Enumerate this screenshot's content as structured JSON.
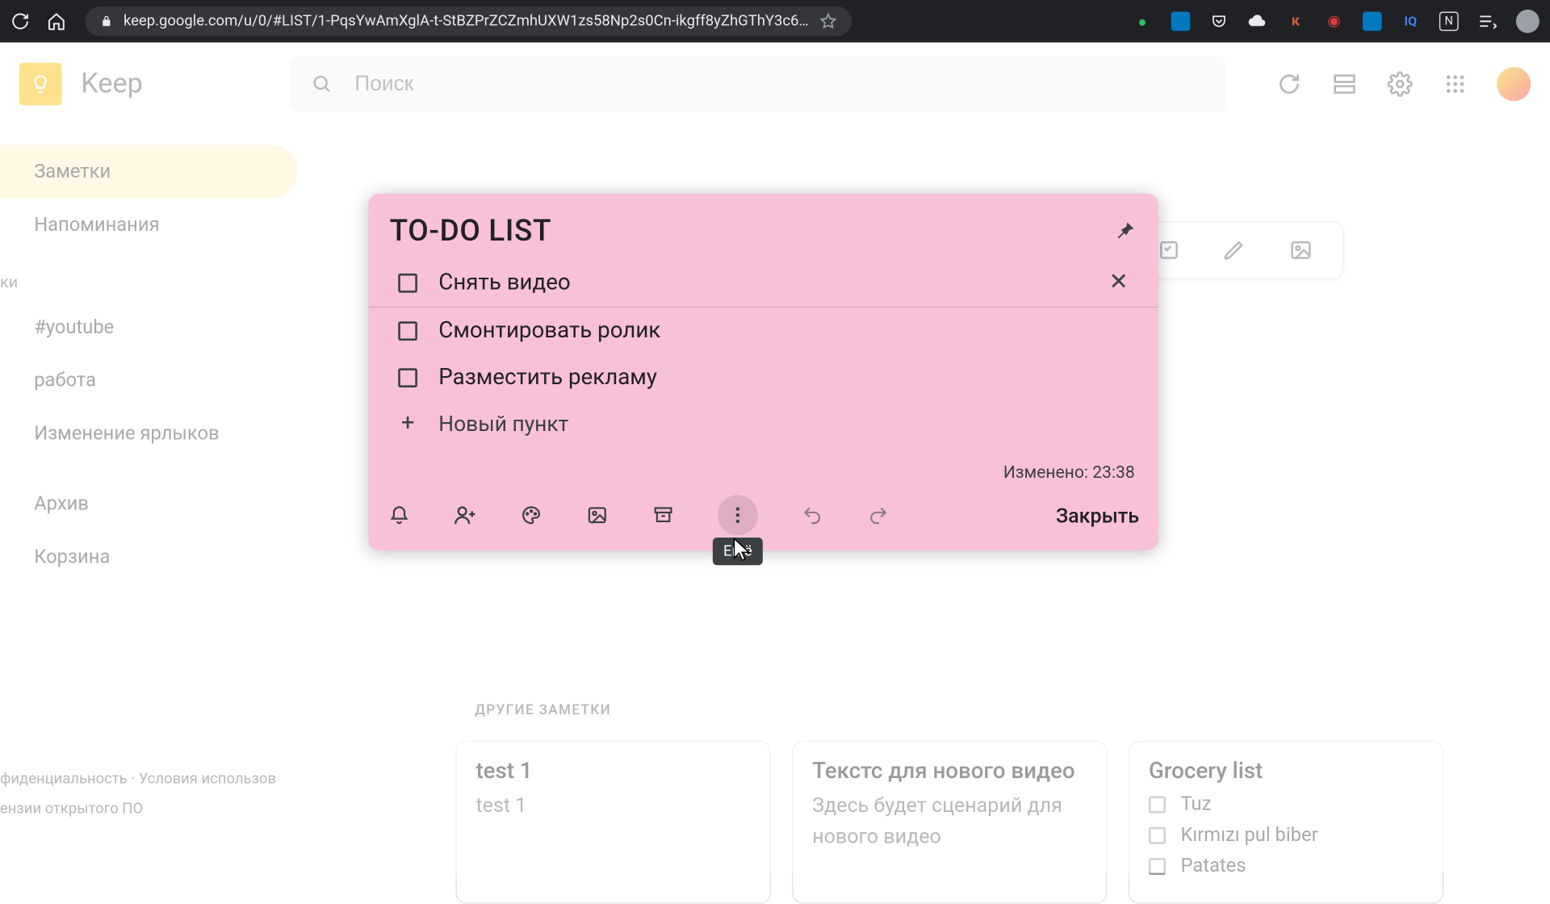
{
  "chrome": {
    "url": "keep.google.com/u/0/#LIST/1-PqsYwAmXglA-t-StBZPrZCZmhUXW1zs58Np2s0Cn-ikgff8yZhGThY3c6…"
  },
  "app": {
    "name": "Keep",
    "search_placeholder": "Поиск"
  },
  "sidebar": {
    "items": [
      {
        "label": "Заметки"
      },
      {
        "label": "Напоминания"
      }
    ],
    "section_label": "ки",
    "labels": [
      {
        "label": "#youtube"
      },
      {
        "label": "работа"
      },
      {
        "label": "Изменение ярлыков"
      }
    ],
    "bottom": [
      {
        "label": "Архив"
      },
      {
        "label": "Корзина"
      }
    ],
    "footer1": "фиденциальность  ·  Условия использов",
    "footer2": "ензии открытого ПО"
  },
  "modal": {
    "title": "TO-DO LIST",
    "items": [
      {
        "text": "Снять видео"
      },
      {
        "text": "Смонтировать ролик"
      },
      {
        "text": "Разместить рекламу"
      }
    ],
    "new_item": "Новый пункт",
    "meta": "Изменено: 23:38",
    "close": "Закрыть",
    "more_tooltip": "Ещё"
  },
  "other": {
    "heading": "ДРУГИЕ ЗАМЕТКИ",
    "cards": [
      {
        "title": "test 1",
        "body": "test 1"
      },
      {
        "title": "Текстс для нового видео",
        "body": "Здесь будет сценарий для нового видео"
      },
      {
        "title": "Grocery list",
        "list": [
          "Tuz",
          "Kırmızı pul biber",
          "Patates"
        ]
      }
    ]
  }
}
